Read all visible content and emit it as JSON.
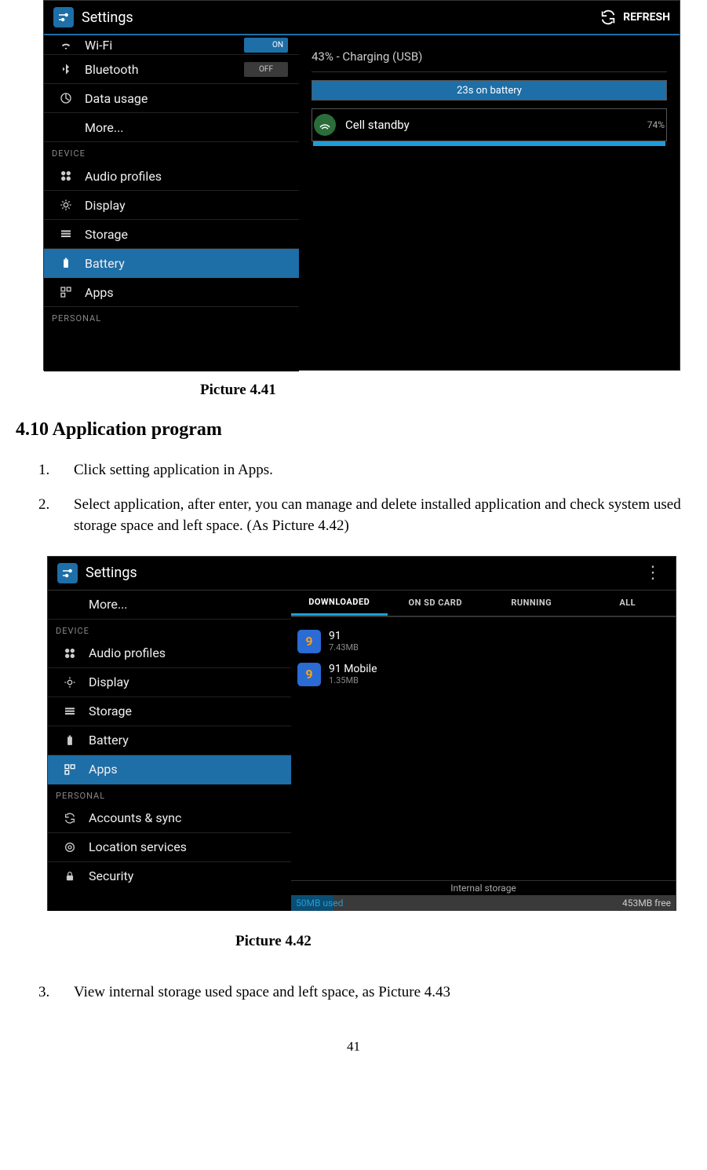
{
  "screenshot1": {
    "title": "Settings",
    "refresh": "REFRESH",
    "sidebar": {
      "wifi": {
        "label": "Wi-Fi",
        "toggle": "ON"
      },
      "bluetooth": {
        "label": "Bluetooth",
        "toggle": "OFF"
      },
      "data_usage": "Data usage",
      "more": "More...",
      "device_header": "DEVICE",
      "audio_profiles": "Audio profiles",
      "display": "Display",
      "storage": "Storage",
      "battery": "Battery",
      "apps": "Apps",
      "personal_header": "PERSONAL"
    },
    "pane": {
      "status": "43% - Charging (USB)",
      "banner": "23s on battery",
      "standby_label": "Cell standby",
      "standby_pct": "74%"
    }
  },
  "caption1": "Picture 4.41",
  "heading": "4.10   Application program",
  "steps": {
    "1": "Click setting application in Apps.",
    "2": "Select application, after enter, you can manage and delete installed application and check system used storage space and left space. (As Picture 4.42)",
    "3": "View internal storage used space and left space, as Picture 4.43"
  },
  "screenshot2": {
    "title": "Settings",
    "sidebar": {
      "more": "More...",
      "device_header": "DEVICE",
      "audio_profiles": "Audio profiles",
      "display": "Display",
      "storage": "Storage",
      "battery": "Battery",
      "apps": "Apps",
      "personal_header": "PERSONAL",
      "accounts_sync": "Accounts & sync",
      "location_services": "Location services",
      "security": "Security"
    },
    "tabs": {
      "downloaded": "DOWNLOADED",
      "on_sd_card": "ON SD CARD",
      "running": "RUNNING",
      "all": "ALL"
    },
    "apps": [
      {
        "name": "91",
        "size": "7.43MB",
        "icon_bg": "#2a6bd4",
        "icon_fg": "#f7a11b",
        "glyph": "9"
      },
      {
        "name": "91 Mobile",
        "size": "1.35MB",
        "icon_bg": "#2a6bd4",
        "icon_fg": "#f7a11b",
        "glyph": "9"
      }
    ],
    "storage": {
      "label": "Internal storage",
      "used": "50MB used",
      "free": "453MB free"
    }
  },
  "caption2": "Picture 4.42",
  "page_number": "41"
}
